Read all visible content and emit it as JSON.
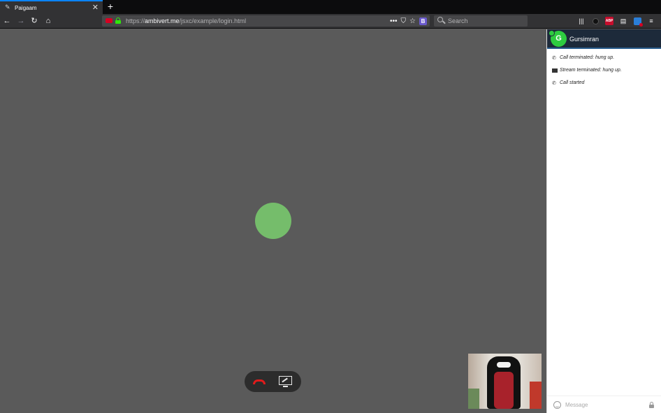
{
  "browser": {
    "tab": {
      "title": "Paigaam"
    },
    "url": {
      "prefix": "https://",
      "domain": "ambivert.me",
      "path": "/jsxc/example/login.html"
    },
    "search": {
      "placeholder": "Search"
    },
    "url_actions": [
      "more-actions-icon",
      "pocket-icon",
      "bookmark-star-icon",
      "b-extension-icon"
    ],
    "toolbar_right": [
      "library-icon",
      "extension-dark-icon",
      "adblock-icon",
      "sidebar-icon",
      "extension-blue-icon",
      "menu-icon"
    ]
  },
  "call": {
    "remote_avatar_color": "#75bd6b",
    "controls": {
      "hangup_color": "#e01b1b"
    }
  },
  "chat": {
    "contact": {
      "initial": "G",
      "name": "Gursimran",
      "status": "online"
    },
    "messages": [
      {
        "icon": "phone-icon",
        "text": "Call terminated: hung up."
      },
      {
        "icon": "camera-icon",
        "text": "Stream terminated: hung up."
      },
      {
        "icon": "phone-icon",
        "text": "Call started"
      }
    ],
    "input": {
      "placeholder": "Message"
    }
  }
}
